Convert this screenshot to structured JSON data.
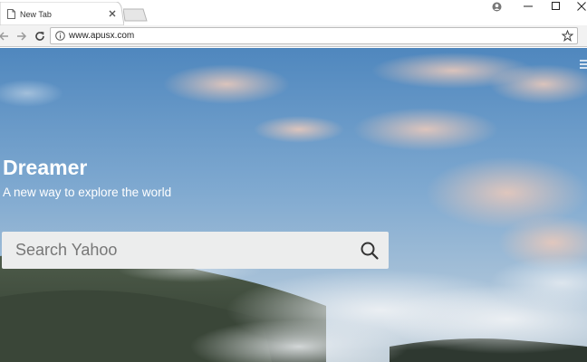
{
  "browser": {
    "tab": {
      "title": "New Tab"
    },
    "address_bar": {
      "url": "www.apusx.com"
    }
  },
  "page": {
    "brand": "Dreamer",
    "tagline": "A new way to explore the world",
    "search": {
      "placeholder": "Search Yahoo"
    }
  },
  "colors": {
    "sky_top": "#5a8fc4",
    "sky_mid": "#8fb6d9",
    "mountain": "#3d4a3c",
    "fog": "#c9cfd4",
    "search_bg": "#eceded"
  }
}
